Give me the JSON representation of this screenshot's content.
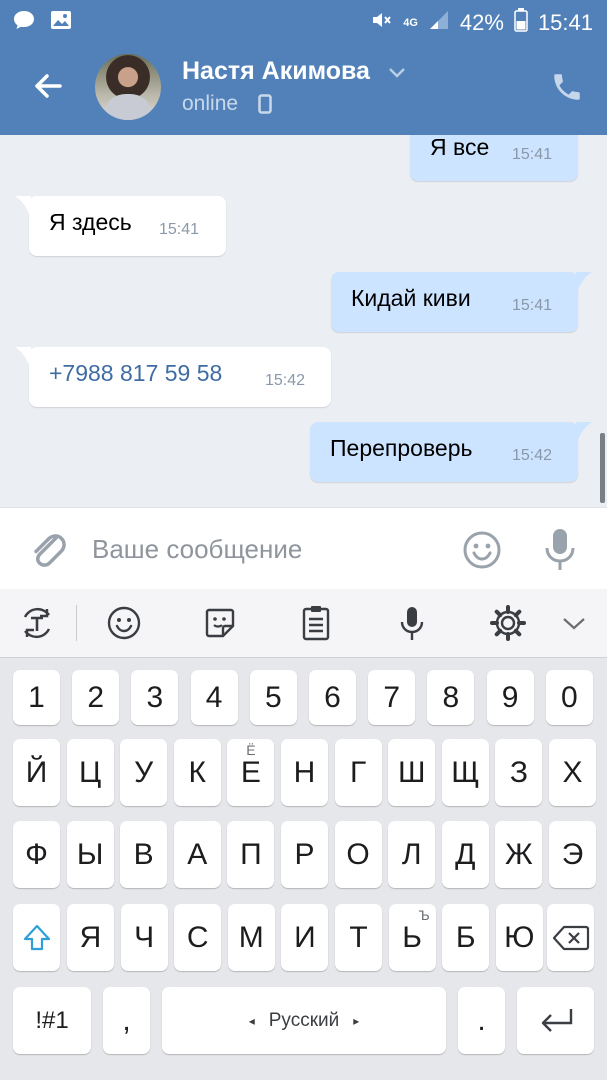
{
  "status_bar": {
    "network": "4G",
    "battery": "42%",
    "time": "15:41"
  },
  "header": {
    "contact_name": "Настя Акимова",
    "status": "online"
  },
  "messages": [
    {
      "direction": "out",
      "text": "Я все",
      "time": "15:41"
    },
    {
      "direction": "in",
      "text": "Я здесь",
      "time": "15:41"
    },
    {
      "direction": "out",
      "text": "Кидай киви",
      "time": "15:41"
    },
    {
      "direction": "in",
      "text": "+7988 817 59 58",
      "time": "15:42",
      "is_link": true
    },
    {
      "direction": "out",
      "text": "Перепроверь",
      "time": "15:42"
    }
  ],
  "input": {
    "placeholder": "Ваше сообщение",
    "value": ""
  },
  "keyboard": {
    "row_numbers": [
      "1",
      "2",
      "3",
      "4",
      "5",
      "6",
      "7",
      "8",
      "9",
      "0"
    ],
    "row1": [
      "Й",
      "Ц",
      "У",
      "К",
      "Е",
      "Н",
      "Г",
      "Ш",
      "Щ",
      "З",
      "Х"
    ],
    "row1_hint_e": "Ё",
    "row2": [
      "Ф",
      "Ы",
      "В",
      "А",
      "П",
      "Р",
      "О",
      "Л",
      "Д",
      "Ж",
      "Э"
    ],
    "row3": [
      "Я",
      "Ч",
      "С",
      "М",
      "И",
      "Т",
      "Ь",
      "Б",
      "Ю"
    ],
    "row3_hint_soft": "Ъ",
    "symbols_key": "!#1",
    "comma_key": ",",
    "space_label": "Русский",
    "period_key": "."
  },
  "colors": {
    "header_bg": "#5181b8",
    "outgoing_bubble": "#cce4ff",
    "incoming_bubble": "#ffffff",
    "chat_bg": "#ebeef3",
    "link": "#3f6ca4"
  }
}
